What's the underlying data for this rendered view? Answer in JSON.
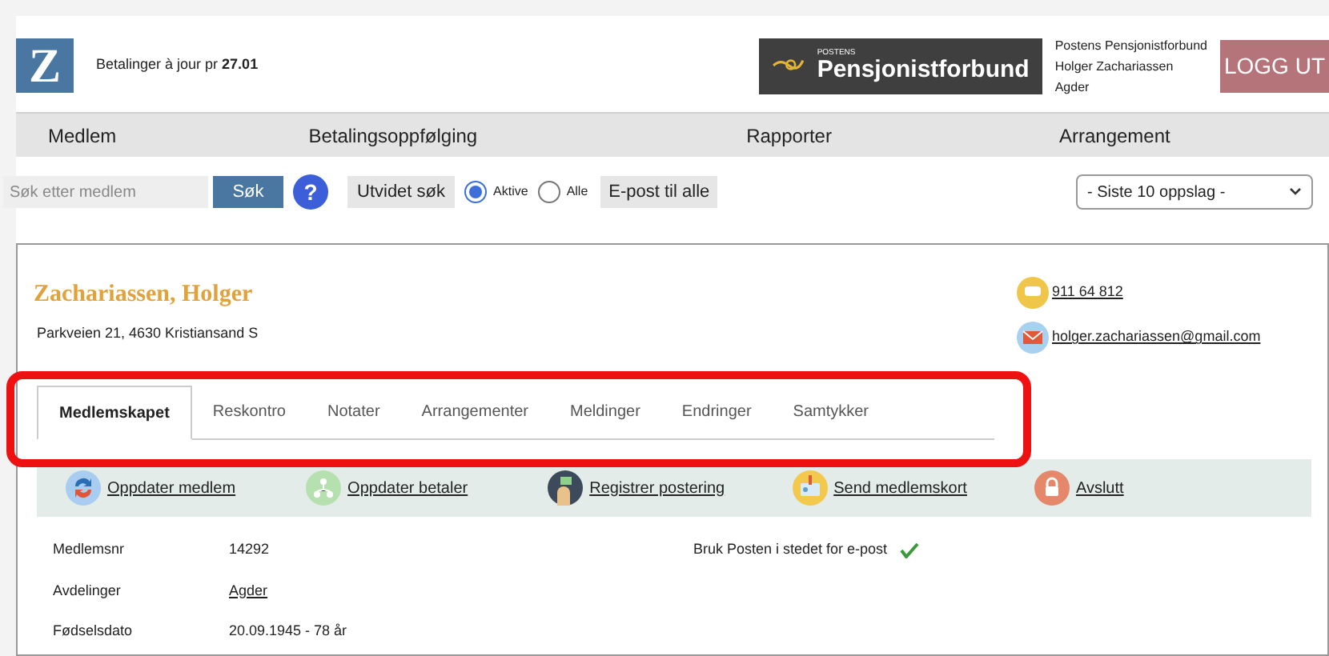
{
  "header": {
    "logo_letter": "Z",
    "payments_status": "Betalinger à jour pr **27.01**",
    "brand": {
      "small": "POSTENS",
      "name": "Pensjonistforbund"
    },
    "account_lines": [
      "Postens Pensjonistforbund",
      "Holger Zachariassen",
      "Agder"
    ],
    "logout": "LOGG UT"
  },
  "nav": [
    "Medlem",
    "Betalingsoppfølging",
    "Rapporter",
    "Arrangement"
  ],
  "search": {
    "placeholder": "Søk etter medlem",
    "button": "Søk",
    "help": "?",
    "advanced": "Utvidet søk",
    "filters": [
      {
        "label": "Aktive",
        "selected": true
      },
      {
        "label": "Alle",
        "selected": false
      }
    ],
    "email_all": "E-post til alle",
    "recent": "- Siste 10 oppslag -"
  },
  "member": {
    "name": "Zachariassen, Holger",
    "address": "Parkveien 21, 4630 Kristiansand S",
    "phone": "911 64 812",
    "email": "holger.zachariassen@gmail.com"
  },
  "tabs": [
    {
      "label": "Medlemskapet",
      "selected": true
    },
    {
      "label": "Reskontro",
      "selected": false
    },
    {
      "label": "Notater",
      "selected": false
    },
    {
      "label": "Arrangementer",
      "selected": false
    },
    {
      "label": "Meldinger",
      "selected": false
    },
    {
      "label": "Endringer",
      "selected": false
    },
    {
      "label": "Samtykker",
      "selected": false
    }
  ],
  "actions": [
    {
      "kind": "update",
      "label": "Oppdater medlem"
    },
    {
      "kind": "payer",
      "label": "Oppdater betaler"
    },
    {
      "kind": "post",
      "label": "Registrer postering"
    },
    {
      "kind": "card",
      "label": "Send medlemskort"
    },
    {
      "kind": "end",
      "label": "Avslutt"
    }
  ],
  "details": [
    {
      "label": "Medlemsnr",
      "value": "14292",
      "link": false
    },
    {
      "label": "Avdelinger",
      "value": "Agder",
      "link": true
    },
    {
      "label": "Fødselsdato",
      "value": "20.09.1945 - 78 år",
      "link": false
    }
  ],
  "preferences": [
    {
      "label": "Bruk Posten i stedet for e-post",
      "checked": true
    }
  ]
}
